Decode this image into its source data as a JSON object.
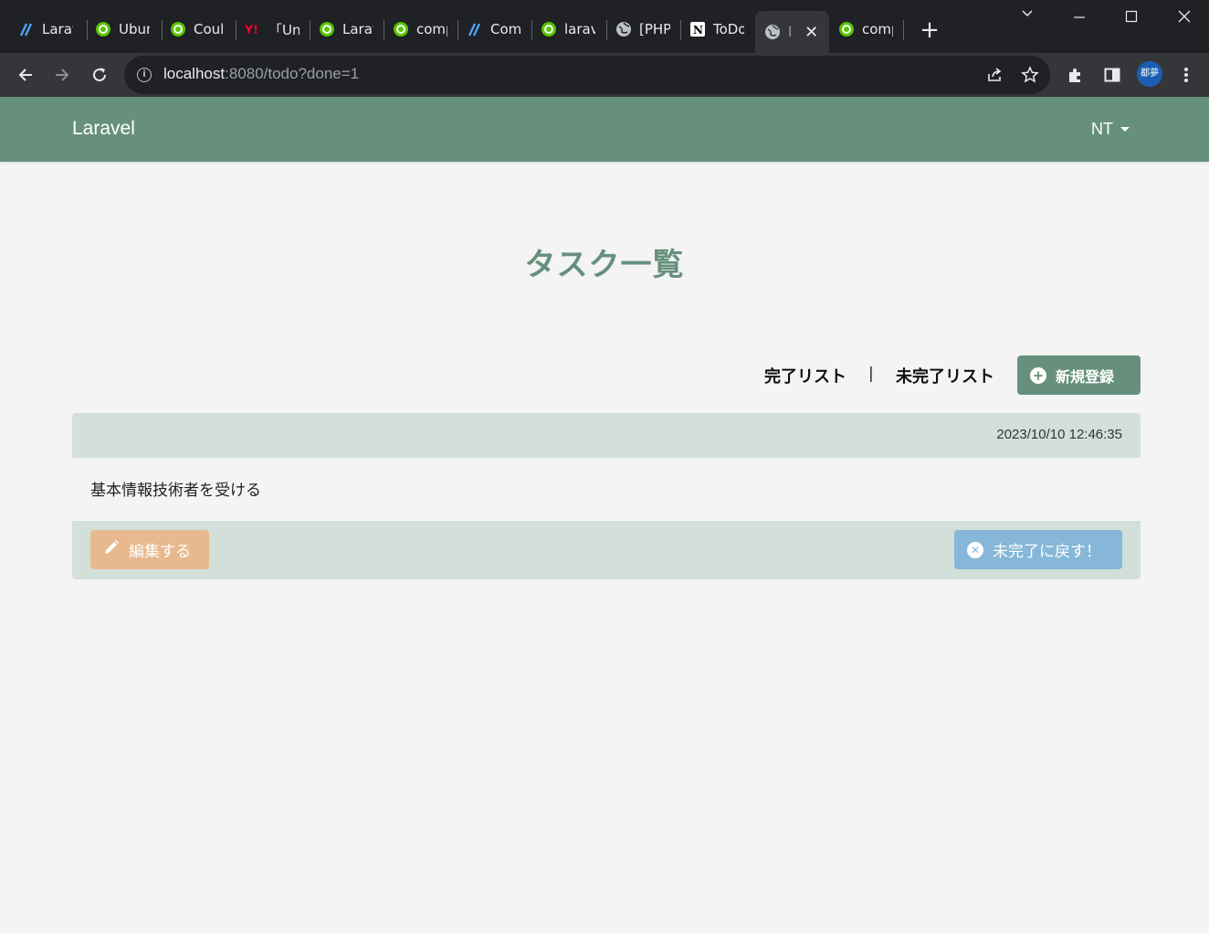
{
  "browser": {
    "tabs": [
      {
        "label": "Larav",
        "icon": "laravel-icon"
      },
      {
        "label": "Ubun",
        "icon": "qiita-icon"
      },
      {
        "label": "Coul",
        "icon": "qiita-icon"
      },
      {
        "label": "「Una",
        "icon": "yahoo-icon"
      },
      {
        "label": "Larav",
        "icon": "qiita-icon"
      },
      {
        "label": "comp",
        "icon": "qiita-icon"
      },
      {
        "label": "Com",
        "icon": "laravel-icon"
      },
      {
        "label": "larav",
        "icon": "qiita-icon"
      },
      {
        "label": "[PHP",
        "icon": "globe-icon"
      },
      {
        "label": "ToDo",
        "icon": "notion-icon"
      },
      {
        "label": "l",
        "icon": "globe-icon",
        "active": true
      },
      {
        "label": "comp",
        "icon": "qiita-icon"
      }
    ],
    "url_host": "localhost",
    "url_rest": ":8080/todo?done=1",
    "profile_label": "都夢"
  },
  "navbar": {
    "brand": "Laravel",
    "user": "NT"
  },
  "main": {
    "title": "タスク一覧",
    "link_done": "完了リスト",
    "separator": "|",
    "link_undone": "未完了リスト",
    "new_button": "新規登録"
  },
  "task": {
    "timestamp": "2023/10/10 12:46:35",
    "text": "基本情報技術者を受ける",
    "edit_button": "編集する",
    "undo_button": "未完了に戻す！"
  },
  "colors": {
    "accent": "#66907c",
    "card_band": "#d2e0d9",
    "edit": "#e8b98f",
    "undo": "#86b7d8"
  }
}
